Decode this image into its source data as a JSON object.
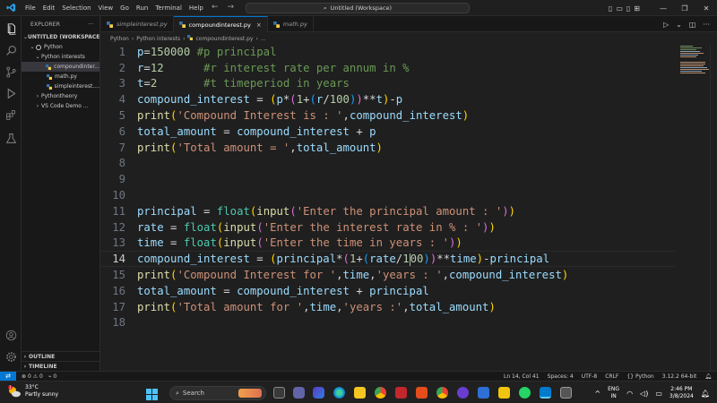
{
  "titlebar": {
    "menu": [
      "File",
      "Edit",
      "Selection",
      "View",
      "Go",
      "Run",
      "Terminal",
      "Help"
    ],
    "search_text": "Untitled (Workspace)"
  },
  "sidebar": {
    "header": "EXPLORER",
    "more": "···",
    "tree": [
      {
        "label": "UNTITLED (WORKSPACE)",
        "level": 0,
        "chevron": "⌄",
        "bold": true,
        "py": false,
        "active": false
      },
      {
        "label": "Python",
        "level": 1,
        "chevron": "⌄",
        "bold": false,
        "py": false,
        "active": false,
        "circle": true
      },
      {
        "label": "Python interests",
        "level": 2,
        "chevron": "⌄",
        "bold": false,
        "py": false,
        "active": false,
        "folder": true
      },
      {
        "label": "compoundinter...",
        "level": 3,
        "chevron": "",
        "bold": false,
        "py": true,
        "active": true
      },
      {
        "label": "math.py",
        "level": 3,
        "chevron": "",
        "bold": false,
        "py": true,
        "active": false
      },
      {
        "label": "simpleinterest....",
        "level": 3,
        "chevron": "",
        "bold": false,
        "py": true,
        "active": false
      },
      {
        "label": "Pythontheory",
        "level": 2,
        "chevron": "›",
        "bold": false,
        "py": false,
        "active": false,
        "folder": true
      },
      {
        "label": "VS Code Demo ...",
        "level": 2,
        "chevron": "›",
        "bold": false,
        "py": false,
        "active": false,
        "folder": true
      }
    ],
    "outline": "OUTLINE",
    "timeline": "TIMELINE"
  },
  "tabs": [
    {
      "label": "simpleinterest.py",
      "active": false
    },
    {
      "label": "compoundinterest.py",
      "active": true
    },
    {
      "label": "math.py",
      "active": false
    }
  ],
  "breadcrumb": [
    "Python",
    "Python interests",
    "compoundinterest.py",
    "..."
  ],
  "editor": {
    "current_line": 14,
    "lines": [
      [
        {
          "t": "p",
          "c": "#9cdcfe"
        },
        {
          "t": "=",
          "c": "#d4d4d4"
        },
        {
          "t": "150000",
          "c": "#b5cea8"
        },
        {
          "t": " #p principal",
          "c": "#6a9955"
        }
      ],
      [
        {
          "t": "r",
          "c": "#9cdcfe"
        },
        {
          "t": "=",
          "c": "#d4d4d4"
        },
        {
          "t": "12",
          "c": "#b5cea8"
        },
        {
          "t": "      #r interest rate per annum in %",
          "c": "#6a9955"
        }
      ],
      [
        {
          "t": "t",
          "c": "#9cdcfe"
        },
        {
          "t": "=",
          "c": "#d4d4d4"
        },
        {
          "t": "2",
          "c": "#b5cea8"
        },
        {
          "t": "       #t timeperiod in years",
          "c": "#6a9955"
        }
      ],
      [
        {
          "t": "compound_interest",
          "c": "#9cdcfe"
        },
        {
          "t": " = ",
          "c": "#d4d4d4"
        },
        {
          "t": "(",
          "c": "#ffd700"
        },
        {
          "t": "p",
          "c": "#9cdcfe"
        },
        {
          "t": "*",
          "c": "#d4d4d4"
        },
        {
          "t": "(",
          "c": "#da70d6"
        },
        {
          "t": "1",
          "c": "#b5cea8"
        },
        {
          "t": "+",
          "c": "#d4d4d4"
        },
        {
          "t": "(",
          "c": "#179fff"
        },
        {
          "t": "r",
          "c": "#9cdcfe"
        },
        {
          "t": "/",
          "c": "#d4d4d4"
        },
        {
          "t": "100",
          "c": "#b5cea8"
        },
        {
          "t": ")",
          "c": "#179fff"
        },
        {
          "t": ")",
          "c": "#da70d6"
        },
        {
          "t": "**",
          "c": "#d4d4d4"
        },
        {
          "t": "t",
          "c": "#9cdcfe"
        },
        {
          "t": ")",
          "c": "#ffd700"
        },
        {
          "t": "-",
          "c": "#d4d4d4"
        },
        {
          "t": "p",
          "c": "#9cdcfe"
        }
      ],
      [
        {
          "t": "print",
          "c": "#dcdcaa"
        },
        {
          "t": "(",
          "c": "#ffd700"
        },
        {
          "t": "'Compound Interest is : '",
          "c": "#ce9178"
        },
        {
          "t": ",",
          "c": "#d4d4d4"
        },
        {
          "t": "compound_interest",
          "c": "#9cdcfe"
        },
        {
          "t": ")",
          "c": "#ffd700"
        }
      ],
      [
        {
          "t": "total_amount",
          "c": "#9cdcfe"
        },
        {
          "t": " = ",
          "c": "#d4d4d4"
        },
        {
          "t": "compound_interest",
          "c": "#9cdcfe"
        },
        {
          "t": " + ",
          "c": "#d4d4d4"
        },
        {
          "t": "p",
          "c": "#9cdcfe"
        }
      ],
      [
        {
          "t": "print",
          "c": "#dcdcaa"
        },
        {
          "t": "(",
          "c": "#ffd700"
        },
        {
          "t": "'Total amount = '",
          "c": "#ce9178"
        },
        {
          "t": ",",
          "c": "#d4d4d4"
        },
        {
          "t": "total_amount",
          "c": "#9cdcfe"
        },
        {
          "t": ")",
          "c": "#ffd700"
        }
      ],
      [],
      [],
      [],
      [
        {
          "t": "principal",
          "c": "#9cdcfe"
        },
        {
          "t": " = ",
          "c": "#d4d4d4"
        },
        {
          "t": "float",
          "c": "#4ec9b0"
        },
        {
          "t": "(",
          "c": "#ffd700"
        },
        {
          "t": "input",
          "c": "#dcdcaa"
        },
        {
          "t": "(",
          "c": "#da70d6"
        },
        {
          "t": "'Enter the principal amount : '",
          "c": "#ce9178"
        },
        {
          "t": ")",
          "c": "#da70d6"
        },
        {
          "t": ")",
          "c": "#ffd700"
        }
      ],
      [
        {
          "t": "rate",
          "c": "#9cdcfe"
        },
        {
          "t": " = ",
          "c": "#d4d4d4"
        },
        {
          "t": "float",
          "c": "#4ec9b0"
        },
        {
          "t": "(",
          "c": "#ffd700"
        },
        {
          "t": "input",
          "c": "#dcdcaa"
        },
        {
          "t": "(",
          "c": "#da70d6"
        },
        {
          "t": "'Enter the interest rate in % : '",
          "c": "#ce9178"
        },
        {
          "t": ")",
          "c": "#da70d6"
        },
        {
          "t": ")",
          "c": "#ffd700"
        }
      ],
      [
        {
          "t": "time",
          "c": "#9cdcfe"
        },
        {
          "t": " = ",
          "c": "#d4d4d4"
        },
        {
          "t": "float",
          "c": "#4ec9b0"
        },
        {
          "t": "(",
          "c": "#ffd700"
        },
        {
          "t": "input",
          "c": "#dcdcaa"
        },
        {
          "t": "(",
          "c": "#da70d6"
        },
        {
          "t": "'Enter the time in years : '",
          "c": "#ce9178"
        },
        {
          "t": ")",
          "c": "#da70d6"
        },
        {
          "t": ")",
          "c": "#ffd700"
        }
      ],
      [
        {
          "t": "compound_interest",
          "c": "#9cdcfe"
        },
        {
          "t": " = ",
          "c": "#d4d4d4"
        },
        {
          "t": "(",
          "c": "#ffd700"
        },
        {
          "t": "principal",
          "c": "#9cdcfe"
        },
        {
          "t": "*",
          "c": "#d4d4d4"
        },
        {
          "t": "(",
          "c": "#da70d6"
        },
        {
          "t": "1",
          "c": "#b5cea8"
        },
        {
          "t": "+",
          "c": "#d4d4d4"
        },
        {
          "t": "(",
          "c": "#179fff"
        },
        {
          "t": "rate",
          "c": "#9cdcfe"
        },
        {
          "t": "/",
          "c": "#d4d4d4"
        },
        {
          "t": "1",
          "c": "#b5cea8"
        },
        {
          "t": "CURSOR",
          "c": ""
        },
        {
          "t": "00",
          "c": "#b5cea8"
        },
        {
          "t": ")",
          "c": "#179fff"
        },
        {
          "t": ")",
          "c": "#da70d6"
        },
        {
          "t": "**",
          "c": "#d4d4d4"
        },
        {
          "t": "time",
          "c": "#9cdcfe"
        },
        {
          "t": ")",
          "c": "#ffd700"
        },
        {
          "t": "-",
          "c": "#d4d4d4"
        },
        {
          "t": "principal",
          "c": "#9cdcfe"
        }
      ],
      [
        {
          "t": "print",
          "c": "#dcdcaa"
        },
        {
          "t": "(",
          "c": "#ffd700"
        },
        {
          "t": "'Compound Interest for '",
          "c": "#ce9178"
        },
        {
          "t": ",",
          "c": "#d4d4d4"
        },
        {
          "t": "time",
          "c": "#9cdcfe"
        },
        {
          "t": ",",
          "c": "#d4d4d4"
        },
        {
          "t": "'years : '",
          "c": "#ce9178"
        },
        {
          "t": ",",
          "c": "#d4d4d4"
        },
        {
          "t": "compound_interest",
          "c": "#9cdcfe"
        },
        {
          "t": ")",
          "c": "#ffd700"
        }
      ],
      [
        {
          "t": "total_amount",
          "c": "#9cdcfe"
        },
        {
          "t": " = ",
          "c": "#d4d4d4"
        },
        {
          "t": "compound_interest",
          "c": "#9cdcfe"
        },
        {
          "t": " + ",
          "c": "#d4d4d4"
        },
        {
          "t": "principal",
          "c": "#9cdcfe"
        }
      ],
      [
        {
          "t": "print",
          "c": "#dcdcaa"
        },
        {
          "t": "(",
          "c": "#ffd700"
        },
        {
          "t": "'Total amount for '",
          "c": "#ce9178"
        },
        {
          "t": ",",
          "c": "#d4d4d4"
        },
        {
          "t": "time",
          "c": "#9cdcfe"
        },
        {
          "t": ",",
          "c": "#d4d4d4"
        },
        {
          "t": "'years :'",
          "c": "#ce9178"
        },
        {
          "t": ",",
          "c": "#d4d4d4"
        },
        {
          "t": "total_amount",
          "c": "#9cdcfe"
        },
        {
          "t": ")",
          "c": "#ffd700"
        }
      ],
      []
    ]
  },
  "statusbar": {
    "errors": "0",
    "warnings": "0",
    "ports": "0",
    "position": "Ln 14, Col 41",
    "spaces": "Spaces: 4",
    "encoding": "UTF-8",
    "eol": "CRLF",
    "language": "Python",
    "interpreter": "3.12.2 64-bit"
  },
  "taskbar": {
    "weather_temp": "33°C",
    "weather_desc": "Partly sunny",
    "weather_badge": "1",
    "search_label": "Search",
    "lang_top": "ENG",
    "lang_bottom": "IN",
    "time": "2:46 PM",
    "date": "3/8/2024"
  },
  "colors": {
    "accent": "#0078d4",
    "editor_bg": "#1f1f1f",
    "sidebar_bg": "#181818"
  }
}
